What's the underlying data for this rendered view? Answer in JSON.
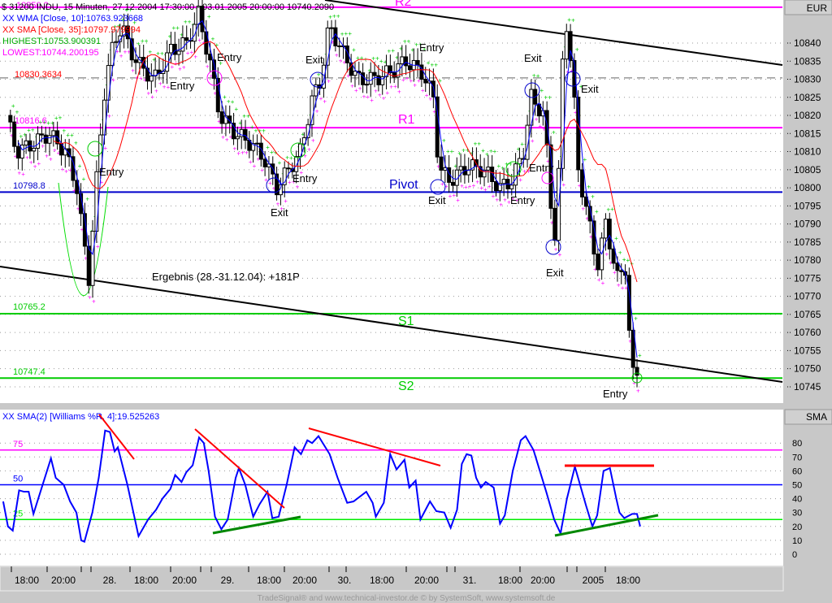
{
  "header": {
    "title": "$ 31200 INDU, 15 Minuten, 27.12.2004 17:30:00 - 03.01.2005 20:00:00  10740.2090",
    "currency": "EUR",
    "lower_axis_label": "SMA"
  },
  "legend": [
    "XX WMA [Close, 10]:10763.923668",
    "XX SMA [Close, 35]:10797.979994",
    "HIGHEST:10753.900391",
    "LOWEST:10744.200195"
  ],
  "colors": {
    "wma": "#0000ff",
    "sma": "#ff0000",
    "highest": "#00cc00",
    "lowest": "#ff00ff",
    "r": "#ff00ff",
    "pivot": "#0000cc",
    "s": "#00dd00"
  },
  "levels": {
    "r2": {
      "label": "R2",
      "value": 10849.9,
      "text": "10850.2"
    },
    "dashed": {
      "value": 10830.3634,
      "text": "10830.3634"
    },
    "r1": {
      "label": "R1",
      "value": 10816.6,
      "text": "10816.6"
    },
    "pivot": {
      "label": "Pivot",
      "value": 10798.8,
      "text": "10798.8"
    },
    "s1": {
      "label": "S1",
      "value": 10765.2,
      "text": "10765.2"
    },
    "s2": {
      "label": "S2",
      "value": 10747.4,
      "text": "10747.4"
    }
  },
  "annotation": "Ergebnis (28.-31.12.04): +181P",
  "signals": {
    "entry": "Entry",
    "exit": "Exit"
  },
  "time_labels": [
    "18:00",
    "20:00",
    "28.",
    "18:00",
    "20:00",
    "29.",
    "18:00",
    "20:00",
    "30.",
    "18:00",
    "20:00",
    "31.",
    "18:00",
    "20:00",
    "2005",
    "18:00"
  ],
  "footer": "TradeSignal® and www.technical-investor.de © by SystemSoft, www.systemsoft.de",
  "chart_data": [
    {
      "type": "candlestick",
      "title": "INDU 15 Minuten",
      "ylabel": "EUR",
      "ylim": [
        10742,
        10852
      ],
      "yticks": [
        10840,
        10835,
        10830,
        10825,
        10820,
        10815,
        10810,
        10805,
        10800,
        10795,
        10790,
        10785,
        10780,
        10775,
        10770,
        10765,
        10760,
        10755,
        10750,
        10745
      ],
      "close_keypoints": [
        [
          0,
          10820
        ],
        [
          2.5,
          10810
        ],
        [
          6.6,
          10812
        ],
        [
          10.8,
          10815
        ],
        [
          15,
          10810
        ],
        [
          18,
          10800
        ],
        [
          19.7,
          10785
        ],
        [
          21,
          10775
        ],
        [
          23.2,
          10805
        ],
        [
          25.3,
          10830
        ],
        [
          27.4,
          10840
        ],
        [
          29.5,
          10845
        ],
        [
          31.5,
          10838
        ],
        [
          34.6,
          10833
        ],
        [
          37.8,
          10830
        ],
        [
          42,
          10838
        ],
        [
          46,
          10840
        ],
        [
          49,
          10848
        ],
        [
          51.9,
          10835
        ],
        [
          54.4,
          10820
        ],
        [
          58.5,
          10815
        ],
        [
          62.7,
          10812
        ],
        [
          65.8,
          10808
        ],
        [
          69,
          10800
        ],
        [
          72,
          10805
        ],
        [
          75,
          10810
        ],
        [
          78.2,
          10825
        ],
        [
          80.3,
          10830
        ],
        [
          82.4,
          10845
        ],
        [
          85.5,
          10838
        ],
        [
          89.6,
          10830
        ],
        [
          93.8,
          10830
        ],
        [
          98,
          10832
        ],
        [
          102,
          10835
        ],
        [
          106,
          10832
        ],
        [
          109,
          10825
        ],
        [
          110.4,
          10805
        ],
        [
          113.5,
          10802
        ],
        [
          117.6,
          10806
        ],
        [
          121.8,
          10805
        ],
        [
          126,
          10800
        ],
        [
          129,
          10802
        ],
        [
          132,
          10810
        ],
        [
          134,
          10825
        ],
        [
          137.3,
          10820
        ],
        [
          139.4,
          10790
        ],
        [
          140.4,
          10785
        ],
        [
          142.5,
          10850
        ],
        [
          144.6,
          10830
        ],
        [
          146,
          10805
        ],
        [
          148.8,
          10790
        ],
        [
          150.8,
          10778
        ],
        [
          153,
          10790
        ],
        [
          156,
          10775
        ],
        [
          158,
          10778
        ],
        [
          159.7,
          10748
        ],
        [
          161,
          10749
        ]
      ]
    },
    {
      "type": "line",
      "title": "XX SMA(2) [Williams %R, 4]:19.525263",
      "ylim": [
        -5,
        95
      ],
      "yticks": [
        80,
        70,
        60,
        50,
        40,
        30,
        20,
        10,
        0
      ],
      "levels": [
        {
          "label": "75",
          "value": 75
        },
        {
          "label": "50",
          "value": 50
        },
        {
          "label": "25",
          "value": 25
        }
      ],
      "points": [
        [
          2,
          38
        ],
        [
          5,
          20
        ],
        [
          8,
          17
        ],
        [
          12,
          46
        ],
        [
          15,
          45
        ],
        [
          18,
          45
        ],
        [
          21,
          29
        ],
        [
          32,
          69
        ],
        [
          35,
          55
        ],
        [
          40,
          50
        ],
        [
          44,
          38
        ],
        [
          48,
          30
        ],
        [
          51,
          10
        ],
        [
          53,
          9
        ],
        [
          58,
          30
        ],
        [
          62,
          55
        ],
        [
          66,
          89
        ],
        [
          69,
          88
        ],
        [
          72,
          74
        ],
        [
          74,
          77
        ],
        [
          80,
          50
        ],
        [
          87,
          13
        ],
        [
          93,
          25
        ],
        [
          98,
          32
        ],
        [
          102,
          40
        ],
        [
          107,
          47
        ],
        [
          110,
          57
        ],
        [
          114,
          52
        ],
        [
          117,
          59
        ],
        [
          121,
          64
        ],
        [
          125,
          84
        ],
        [
          128,
          80
        ],
        [
          131,
          60
        ],
        [
          135,
          27
        ],
        [
          139,
          18
        ],
        [
          143,
          25
        ],
        [
          148,
          55
        ],
        [
          150,
          62
        ],
        [
          154,
          50
        ],
        [
          159,
          27
        ],
        [
          163,
          36
        ],
        [
          168,
          45
        ],
        [
          171,
          26
        ],
        [
          175,
          27
        ],
        [
          180,
          50
        ],
        [
          185,
          77
        ],
        [
          189,
          72
        ],
        [
          193,
          82
        ],
        [
          196,
          80
        ],
        [
          200,
          85
        ],
        [
          207,
          72
        ],
        [
          212,
          55
        ],
        [
          218,
          37
        ],
        [
          222,
          38
        ],
        [
          230,
          45
        ],
        [
          234,
          37
        ],
        [
          236,
          27
        ],
        [
          241,
          37
        ],
        [
          245,
          72
        ],
        [
          249,
          61
        ],
        [
          254,
          68
        ],
        [
          257,
          48
        ],
        [
          261,
          53
        ],
        [
          264,
          25
        ],
        [
          270,
          38
        ],
        [
          274,
          31
        ],
        [
          279,
          30
        ],
        [
          283,
          19
        ],
        [
          287,
          32
        ],
        [
          290,
          65
        ],
        [
          293,
          72
        ],
        [
          296,
          71
        ],
        [
          299,
          55
        ],
        [
          302,
          48
        ],
        [
          305,
          52
        ],
        [
          310,
          48
        ],
        [
          314,
          22
        ],
        [
          317,
          28
        ],
        [
          322,
          60
        ],
        [
          327,
          82
        ],
        [
          330,
          85
        ],
        [
          335,
          75
        ],
        [
          339,
          60
        ],
        [
          343,
          45
        ],
        [
          348,
          25
        ],
        [
          352,
          15
        ],
        [
          356,
          40
        ],
        [
          361,
          63
        ],
        [
          368,
          35
        ],
        [
          372,
          20
        ],
        [
          375,
          28
        ],
        [
          379,
          60
        ],
        [
          383,
          62
        ],
        [
          387,
          40
        ],
        [
          389,
          30
        ],
        [
          392,
          26
        ],
        [
          397,
          29
        ],
        [
          400,
          29
        ],
        [
          402,
          20
        ]
      ]
    }
  ]
}
